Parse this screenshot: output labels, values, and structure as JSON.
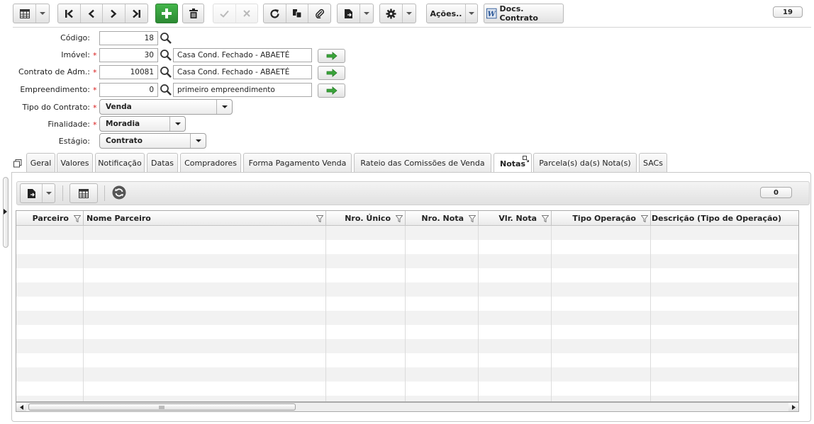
{
  "toolbar": {
    "actions_label": "Ações..",
    "docs_label": "Docs. Contrato",
    "record_count": "19"
  },
  "form": {
    "codigo": {
      "label": "Código:",
      "value": "18"
    },
    "imovel": {
      "label": "Imóvel:",
      "required_mark": "*",
      "value": "30",
      "description": "Casa Cond. Fechado - ABAETÉ"
    },
    "contrato_adm": {
      "label": "Contrato de Adm.:",
      "required_mark": "*",
      "value": "10081",
      "description": "Casa Cond. Fechado - ABAETÉ"
    },
    "empreendimento": {
      "label": "Empreendimento:",
      "required_mark": "*",
      "value": "0",
      "description": "primeiro empreendimento"
    },
    "tipo_contrato": {
      "label": "Tipo do Contrato:",
      "required_mark": "*",
      "value": "Venda"
    },
    "finalidade": {
      "label": "Finalidade:",
      "required_mark": "*",
      "value": "Moradia"
    },
    "estagio": {
      "label": "Estágio:",
      "value": "Contrato"
    }
  },
  "tabs": [
    {
      "label": "Geral"
    },
    {
      "label": "Valores"
    },
    {
      "label": "Notificação"
    },
    {
      "label": "Datas"
    },
    {
      "label": "Compradores"
    },
    {
      "label": "Forma Pagamento Venda"
    },
    {
      "label": "Rateio das Comissões de Venda"
    },
    {
      "label": "Notas"
    },
    {
      "label": "Parcela(s) da(s) Nota(s)"
    },
    {
      "label": "SACs"
    }
  ],
  "active_tab": "Notas",
  "grid": {
    "record_count": "0",
    "columns": [
      {
        "label": "Parceiro"
      },
      {
        "label": "Nome Parceiro"
      },
      {
        "label": "Nro. Único"
      },
      {
        "label": "Nro. Nota"
      },
      {
        "label": "Vlr. Nota"
      },
      {
        "label": "Tipo Operação"
      },
      {
        "label": "Descrição (Tipo de Operação)"
      }
    ],
    "rows": []
  },
  "colors": {
    "required": "#d81b1b",
    "add_button": "#2c8a33",
    "word_icon": "#2b5797",
    "go_arrow": "#3aa53a"
  }
}
